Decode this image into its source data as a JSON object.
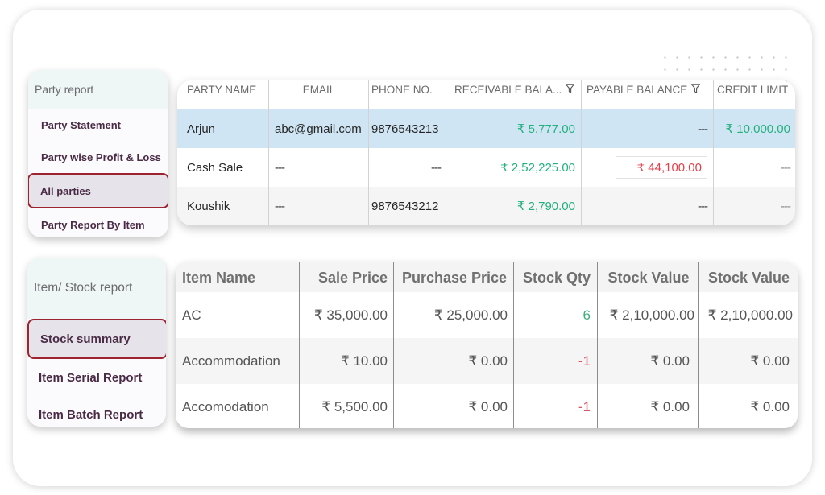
{
  "party_menu": {
    "title": "Party report",
    "items": [
      {
        "label": "Party Statement",
        "selected": false
      },
      {
        "label": "Party wise Profit & Loss",
        "selected": false
      },
      {
        "label": "All parties",
        "selected": true
      },
      {
        "label": "Party Report By Item",
        "selected": false
      }
    ]
  },
  "stock_menu": {
    "title": "Item/ Stock report",
    "items": [
      {
        "label": "Stock summary",
        "selected": true
      },
      {
        "label": "Item Serial Report",
        "selected": false
      },
      {
        "label": "Item Batch Report",
        "selected": false
      }
    ]
  },
  "party_table": {
    "columns": [
      "PARTY NAME",
      "EMAIL",
      "PHONE NO.",
      "RECEIVABLE BALA...",
      "PAYABLE BALANCE",
      "CREDIT LIMIT"
    ],
    "rows": [
      {
        "name": "Arjun",
        "email": "abc@gmail.com",
        "phone": "9876543213",
        "receivable": "₹ 5,777.00",
        "payable": "---",
        "credit": "₹ 10,000.00"
      },
      {
        "name": "Cash Sale",
        "email": "---",
        "phone": "---",
        "receivable": "₹ 2,52,225.00",
        "payable": "₹ 44,100.00",
        "credit": "---"
      },
      {
        "name": "Koushik",
        "email": "---",
        "phone": "9876543212",
        "receivable": "₹ 2,790.00",
        "payable": "---",
        "credit": "---"
      }
    ]
  },
  "stock_table": {
    "columns": [
      "Item Name",
      "Sale Price",
      "Purchase Price",
      "Stock Qty",
      "Stock Value",
      "Stock Value"
    ],
    "rows": [
      {
        "name": "AC",
        "sale": "₹ 35,000.00",
        "purchase": "₹ 25,000.00",
        "qty": "6",
        "value1": "₹ 2,10,000.00",
        "value2": "₹ 2,10,000.00"
      },
      {
        "name": "Accommodation",
        "sale": "₹ 10.00",
        "purchase": "₹ 0.00",
        "qty": "-1",
        "value1": "₹ 0.00",
        "value2": "₹ 0.00"
      },
      {
        "name": "Accomodation",
        "sale": "₹ 5,500.00",
        "purchase": "₹ 0.00",
        "qty": "-1",
        "value1": "₹ 0.00",
        "value2": "₹ 0.00"
      }
    ]
  },
  "colors": {
    "accent_selected_border": "#9e2331",
    "positive": "#22b07d",
    "negative": "#e2404b",
    "row_highlight": "#cfe5f4"
  }
}
